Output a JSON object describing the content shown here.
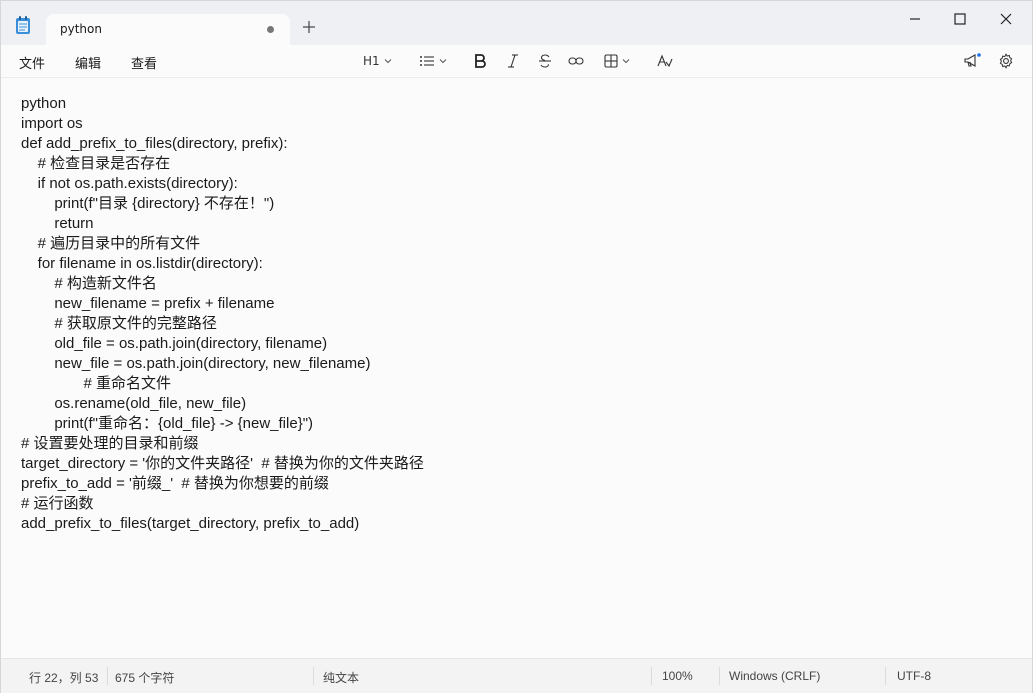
{
  "tab": {
    "title": "python"
  },
  "menu": {
    "file": "文件",
    "edit": "编辑",
    "view": "查看"
  },
  "toolbar": {
    "heading": "H1"
  },
  "code_lines": [
    "python",
    "import os",
    "def add_prefix_to_files(directory, prefix):",
    "    # 检查目录是否存在",
    "    if not os.path.exists(directory):",
    "        print(f\"目录 {directory} 不存在！\")",
    "        return",
    "    # 遍历目录中的所有文件",
    "    for filename in os.listdir(directory):",
    "        # 构造新文件名",
    "        new_filename = prefix + filename",
    "        # 获取原文件的完整路径",
    "        old_file = os.path.join(directory, filename)",
    "        new_file = os.path.join(directory, new_filename)",
    "               # 重命名文件",
    "        os.rename(old_file, new_file)",
    "        print(f\"重命名：{old_file} -> {new_file}\")",
    "# 设置要处理的目录和前缀",
    "target_directory = '你的文件夹路径'  # 替换为你的文件夹路径",
    "prefix_to_add = '前缀_'  # 替换为你想要的前缀",
    "# 运行函数",
    "add_prefix_to_files(target_directory, prefix_to_add)"
  ],
  "status": {
    "position": "行 22，列 53",
    "char_count": "675 个字符",
    "format": "纯文本",
    "zoom": "100%",
    "line_ending": "Windows (CRLF)",
    "encoding": "UTF-8"
  },
  "icons": {
    "app": "notepad-icon",
    "close_tab": "unsaved-dot-icon",
    "new_tab": "plus-icon",
    "minimize": "minimize-icon",
    "maximize": "maximize-icon",
    "close": "close-icon",
    "list": "list-icon",
    "bold": "bold-icon",
    "italic": "italic-icon",
    "strike": "strikethrough-icon",
    "link": "link-icon",
    "table": "table-icon",
    "clear_format": "clear-format-icon",
    "notifications": "megaphone-icon",
    "settings": "gear-icon"
  },
  "colors": {
    "accent": "#1a73e8",
    "background": "#fbfbfb",
    "chrome": "#eef0f3"
  }
}
